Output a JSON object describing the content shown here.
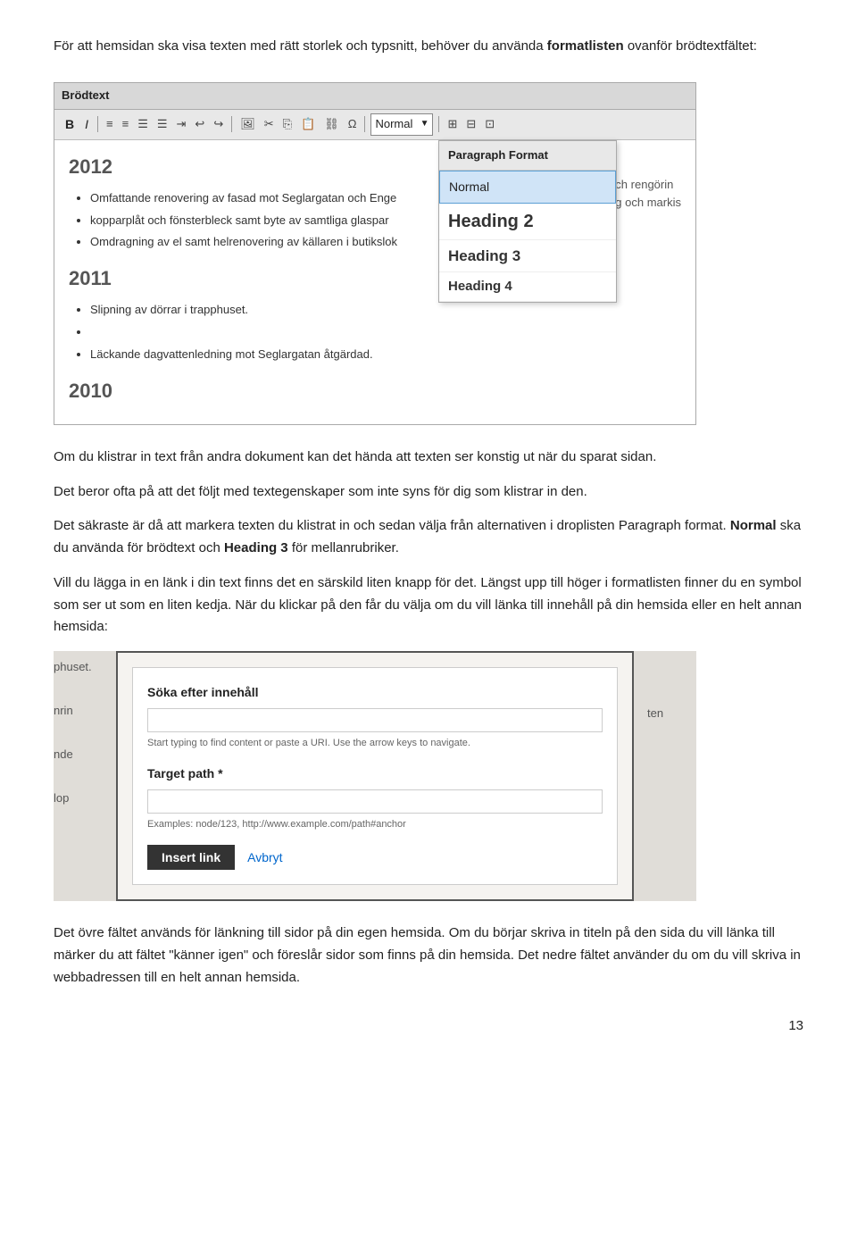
{
  "intro": {
    "line1": "För att hemsidan ska visa texten med rätt storlek och typsnitt, behöver du använda",
    "line1_bold": "formatlisten",
    "line1_rest": " ovanför brödtextfältet:"
  },
  "screenshot1": {
    "title": "Brödtext",
    "toolbar": {
      "bold": "B",
      "italic": "I",
      "normal_label": "Normal"
    },
    "content": {
      "year1": "2012",
      "bullet1a": "Omfattande renovering av fasad mot Seglargatan och Enge",
      "bullet1b": "kopparplåt och fönsterbleck samt byte av samtliga glaspar",
      "bullet2": "Omdragning av el samt helrenovering av källaren i butikslok",
      "year2": "2011",
      "bullet3": "Slipning av dörrar i trapphuset.",
      "bullet4": "Läckande dagvattenledning mot Seglargatan åtgärdad.",
      "year3": "2010",
      "suffix1": "och rengörin",
      "suffix2": "ng och markis"
    },
    "dropdown": {
      "header": "Paragraph Format",
      "items": [
        {
          "label": "Normal",
          "selected": true
        },
        {
          "label": "Heading 2",
          "style": "heading2"
        },
        {
          "label": "Heading 3",
          "style": "heading3"
        },
        {
          "label": "Heading 4",
          "style": "heading4"
        }
      ]
    }
  },
  "paragraph1": "Om du klistrar in text från andra dokument kan det hända att texten ser konstig ut när du sparat sidan.",
  "paragraph2": "Det beror ofta på att det följt med textegenskaper som inte syns för dig som klistrar in den.",
  "paragraph3_part1": "Det säkraste är då att markera texten du klistrat in och sedan välja från alternativen i droplisten Paragraph format. ",
  "paragraph3_bold1": "Normal",
  "paragraph3_part2": " ska du använda för brödtext och ",
  "paragraph3_bold2": "Heading 3",
  "paragraph3_part3": " för mellanrubriker.",
  "paragraph4": "Vill du lägga in en länk i din text finns det en särskild liten knapp för det. Längst upp till höger i formatlisten finner du en symbol som ser ut som en liten kedja. När du klickar på den får du välja om du vill länka till innehåll på din hemsida eller en helt annan hemsida:",
  "screenshot2": {
    "bg_lines": [
      "phuset.",
      "nrin",
      "nde",
      "lop",
      "",
      "",
      "",
      "",
      "",
      "",
      ""
    ],
    "bg_right_lines": [
      "ten",
      ""
    ],
    "dialog": {
      "search_label": "Söka efter innehåll",
      "search_placeholder": "",
      "search_hint": "Start typing to find content or paste a URI. Use the arrow keys to navigate.",
      "target_label": "Target path *",
      "target_placeholder": "",
      "target_example": "Examples: node/123, http://www.example.com/path#anchor",
      "insert_btn": "Insert link",
      "cancel_btn": "Avbryt"
    }
  },
  "paragraph5": "Det övre fältet används för länkning till sidor på din egen hemsida. Om du börjar skriva in titeln på den sida du vill länka till märker du att fältet \"känner igen\" och föreslår sidor som finns på din hemsida. Det nedre fältet använder du om du vill skriva in webbadressen till en helt annan hemsida.",
  "page_number": "13"
}
